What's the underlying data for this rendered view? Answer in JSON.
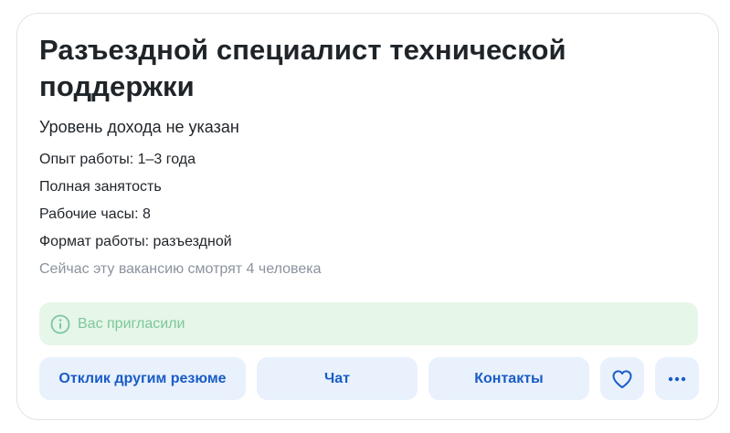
{
  "vacancy": {
    "title": "Разъездной специалист технической поддержки",
    "salary": "Уровень дохода не указан",
    "experience": "Опыт работы: 1–3 года",
    "employment": "Полная занятость",
    "hours": "Рабочие часы: 8",
    "format": "Формат работы: разъездной",
    "watchers": "Сейчас эту вакансию смотрят 4 человека"
  },
  "status": {
    "text": "Вас пригласили",
    "icon": "info-icon"
  },
  "actions": {
    "respond_other_resume": "Отклик другим резюме",
    "chat": "Чат",
    "contacts": "Контакты",
    "favorite_icon": "heart-icon",
    "more_icon": "more-dots-icon"
  },
  "colors": {
    "accent": "#1a5cc7",
    "button_bg": "#e8f1fc",
    "success_bg": "#e6f6e9",
    "success_text": "#7cc79a",
    "muted_text": "#8a939e",
    "title_text": "#1f2429"
  }
}
